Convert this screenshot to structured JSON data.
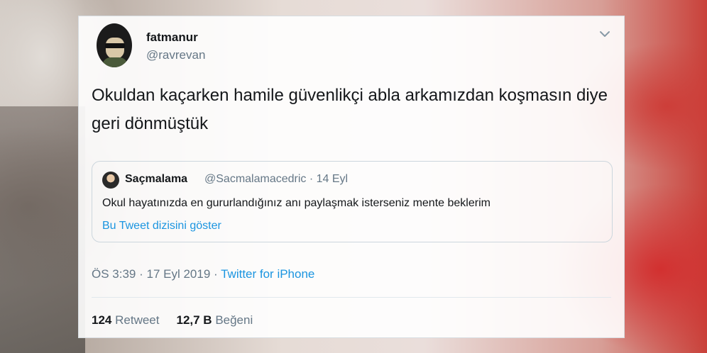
{
  "tweet": {
    "display_name": "fatmanur",
    "handle": "@ravrevan",
    "text": "Okuldan kaçarken hamile güvenlikçi abla arkamızdan koşmasın diye geri dönmüştük",
    "time": "ÖS 3:39",
    "date": "17 Eyl 2019",
    "source": "Twitter for iPhone",
    "retweet_count": "124",
    "retweet_label": "Retweet",
    "like_count": "12,7 B",
    "like_label": "Beğeni"
  },
  "quoted": {
    "display_name": "Saçmalama",
    "handle": "@Sacmalamacedric",
    "date": "14 Eyl",
    "text": "Okul hayatınızda en gururlandığınız anı paylaşmak isterseniz mente beklerim",
    "thread_link": "Bu Tweet dizisini göster"
  },
  "icons": {
    "menu": "chevron-down-icon"
  },
  "colors": {
    "link": "#1b95e0",
    "muted": "#657786",
    "text": "#14171a"
  }
}
